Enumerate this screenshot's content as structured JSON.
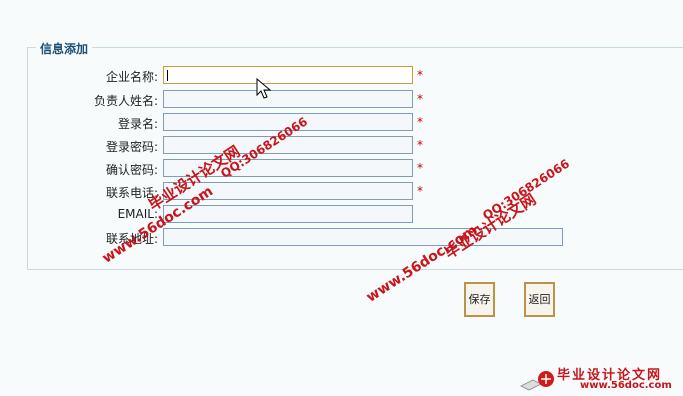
{
  "form": {
    "legend": "信息添加",
    "fields": [
      {
        "label": "企业名称:",
        "value": "",
        "required": "*"
      },
      {
        "label": "负责人姓名:",
        "value": "",
        "required": "*"
      },
      {
        "label": "登录名:",
        "value": "",
        "required": "*"
      },
      {
        "label": "登录密码:",
        "value": "",
        "required": "*"
      },
      {
        "label": "确认密码:",
        "value": "",
        "required": "*"
      },
      {
        "label": "联系电话:",
        "value": "",
        "required": "*"
      },
      {
        "label": "EMAIL:",
        "value": ""
      },
      {
        "label": "联系地址:",
        "value": ""
      }
    ]
  },
  "buttons": {
    "save": "保存",
    "back": "返回"
  },
  "watermark": {
    "site_cn": "毕业设计论文网",
    "url": "www.56doc.com",
    "qq": "QQ:306826066"
  },
  "colors": {
    "accent": "#1e4f76",
    "required": "#cc0000",
    "button_border": "#b8934a",
    "watermark": "#c8141a"
  }
}
